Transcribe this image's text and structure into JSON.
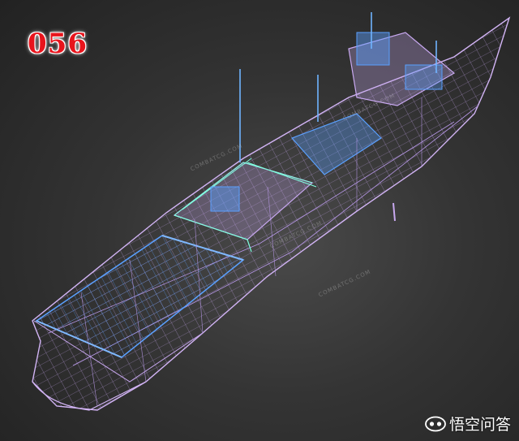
{
  "image_label": "056",
  "watermarks": [
    "COMBATCG.COM",
    "COMBATCG.COM",
    "COMBATCG.COM",
    "COMBATCG.COM"
  ],
  "brand": {
    "name": "悟空问答",
    "icon": "wukong-logo-icon"
  },
  "colors": {
    "hull_wire": "#c8a8f0",
    "superstructure_wire": "#5aa0ff",
    "railing_wire": "#7fffe0",
    "label_red": "#e8141c"
  }
}
